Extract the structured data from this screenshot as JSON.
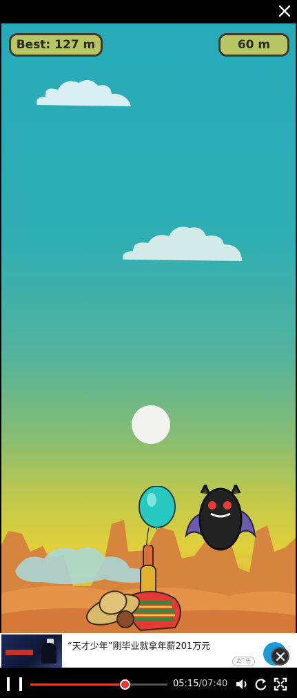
{
  "top_bar": {
    "close_icon": "close-icon"
  },
  "hud": {
    "best": "Best: 127 m",
    "score": "60 m"
  },
  "ad": {
    "headline": "“天才少年”刚毕业就拿年薪201万元",
    "tag": "Z广告",
    "close_icon": "close-icon"
  },
  "player": {
    "current_time": "05:15",
    "duration": "07:40",
    "separator": "/",
    "progress_fraction": 0.686,
    "icons": [
      "pause-icon",
      "volume-icon",
      "replay-icon",
      "fullscreen-icon"
    ]
  },
  "colors": {
    "accent": "#e53b34",
    "hud_fill": "#b9c562",
    "hud_border": "#3d3a27"
  }
}
